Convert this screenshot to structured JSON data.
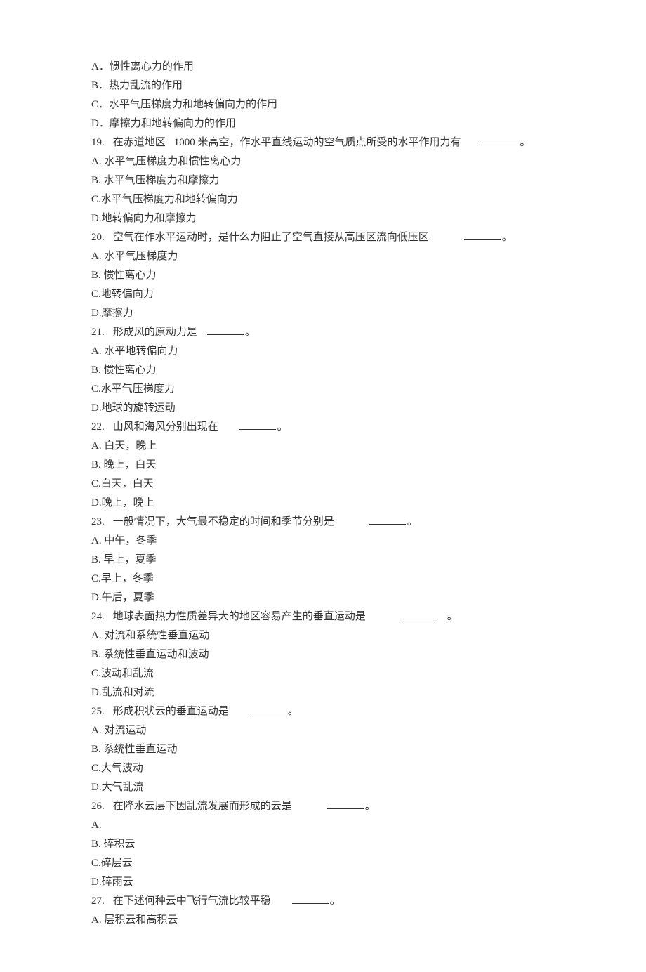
{
  "options_prefix": {
    "q18": {
      "A": "A．惯性离心力的作用",
      "B": "B．热力乱流的作用",
      "C": "C．水平气压梯度力和地转偏向力的作用",
      "D": "D．摩擦力和地转偏向力的作用"
    }
  },
  "q19": {
    "num": "19.",
    "stem_a": "在赤道地区",
    "stem_b": "1000 米高空，作水平直线运动的空气质点所受的水平作用力有",
    "A": "A. 水平气压梯度力和惯性离心力",
    "B": "B. 水平气压梯度力和摩擦力",
    "C": "C.水平气压梯度力和地转偏向力",
    "D": "D.地转偏向力和摩擦力"
  },
  "q20": {
    "num": "20.",
    "stem": "空气在作水平运动时，是什么力阻止了空气直接从高压区流向低压区",
    "A": "A. 水平气压梯度力",
    "B": "B. 惯性离心力",
    "C": "C.地转偏向力",
    "D": "D.摩擦力"
  },
  "q21": {
    "num": "21.",
    "stem": "形成风的原动力是",
    "A": "A. 水平地转偏向力",
    "B": "B. 惯性离心力",
    "C": "C.水平气压梯度力",
    "D": "D.地球的旋转运动"
  },
  "q22": {
    "num": "22.",
    "stem": "山风和海风分别出现在",
    "A": "A. 白天，晚上",
    "B": "B. 晚上，白天",
    "C": "C.白天，白天",
    "D": "D.晚上，晚上"
  },
  "q23": {
    "num": "23.",
    "stem": "一般情况下，大气最不稳定的时间和季节分别是",
    "A": "A. 中午，冬季",
    "B": "B. 早上，夏季",
    "C": "C.早上，冬季",
    "D": "D.午后，夏季"
  },
  "q24": {
    "num": "24.",
    "stem": "地球表面热力性质差异大的地区容易产生的垂直运动是",
    "A": "A. 对流和系统性垂直运动",
    "B": "B. 系统性垂直运动和波动",
    "C": "C.波动和乱流",
    "D": "D.乱流和对流"
  },
  "q25": {
    "num": "25.",
    "stem": "形成积状云的垂直运动是",
    "A": "A. 对流运动",
    "B": "B. 系统性垂直运动",
    "C": "C.大气波动",
    "D": "D.大气乱流"
  },
  "q26": {
    "num": "26.",
    "stem": "在降水云层下因乱流发展而形成的云是",
    "A": "A.",
    "B": "B. 碎积云",
    "C": "C.碎层云",
    "D": "D.碎雨云"
  },
  "q27": {
    "num": "27.",
    "stem": "在下述何种云中飞行气流比较平稳",
    "A": "A. 层积云和高积云"
  },
  "punct": {
    "period": "。"
  }
}
